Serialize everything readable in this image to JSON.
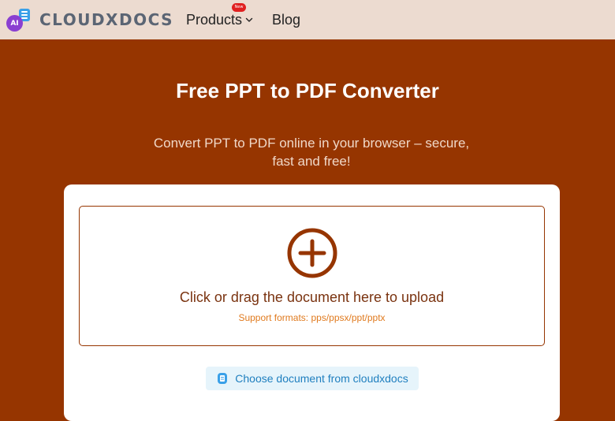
{
  "header": {
    "logo_badge": "AI",
    "brand": "CLOUDXDOCS",
    "nav": {
      "products_label": "Products",
      "products_badge": "New",
      "blog_label": "Blog"
    }
  },
  "hero": {
    "title": "Free PPT to PDF Converter",
    "subtitle": "Convert PPT to PDF online in your browser – secure, fast and free!"
  },
  "upload": {
    "prompt": "Click or drag the document here to upload",
    "formats": "Support formats: pps/ppsx/ppt/pptx",
    "choose_label": "Choose document from cloudxdocs"
  },
  "colors": {
    "brand_primary": "#963500",
    "header_bg": "#ecdbd0",
    "accent_orange": "#e07a1e",
    "link_blue": "#1f7fbf"
  },
  "icons": {
    "logo": "cloudxdocs-logo-icon",
    "products_chevron": "chevron-down-icon",
    "upload": "plus-circle-icon",
    "choose": "document-icon"
  }
}
